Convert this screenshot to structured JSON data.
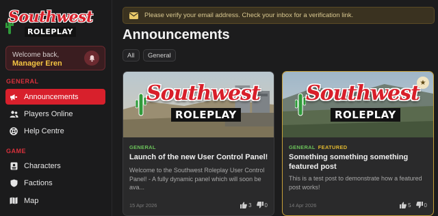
{
  "sidebar": {
    "logo": {
      "line1": "Southwest",
      "line2": "ROLEPLAY"
    },
    "welcome": {
      "greeting": "Welcome back,",
      "username": "Manager Eren"
    },
    "sections": [
      {
        "label": "GENERAL",
        "items": [
          {
            "label": "Announcements",
            "icon": "megaphone-icon",
            "active": true
          },
          {
            "label": "Players Online",
            "icon": "users-icon",
            "active": false
          },
          {
            "label": "Help Centre",
            "icon": "lifebuoy-icon",
            "active": false
          }
        ]
      },
      {
        "label": "GAME",
        "items": [
          {
            "label": "Characters",
            "icon": "id-card-icon",
            "active": false
          },
          {
            "label": "Factions",
            "icon": "shield-icon",
            "active": false
          },
          {
            "label": "Map",
            "icon": "map-icon",
            "active": false
          }
        ]
      }
    ]
  },
  "banner": {
    "text": "Please verify your email address. Check your inbox for a verification link.",
    "icon": "envelope-icon"
  },
  "page_title": "Announcements",
  "filters": [
    "All",
    "General"
  ],
  "cards": [
    {
      "logo1": "Southwest",
      "logo2": "ROLEPLAY",
      "tags": [
        "GENERAL"
      ],
      "featured": false,
      "title": "Launch of the new User Control Panel!",
      "description": "Welcome to the Southwest Roleplay User Control Panel! - A fully dynamic panel which will soon be ava...",
      "date": "15 Apr 2026",
      "likes": "3",
      "dislikes": "0"
    },
    {
      "logo1": "Southwest",
      "logo2": "ROLEPLAY",
      "tags": [
        "GENERAL",
        "FEATURED"
      ],
      "featured": true,
      "title": "Something something something featured post",
      "description": "This is a test post to demonstrate how a featured post works!",
      "date": "14 Apr 2026",
      "likes": "5",
      "dislikes": "0"
    }
  ],
  "colors": {
    "accent": "#d8202c",
    "featured": "#c9a23a",
    "general_tag": "#6bc25a",
    "username": "#f5c542"
  }
}
